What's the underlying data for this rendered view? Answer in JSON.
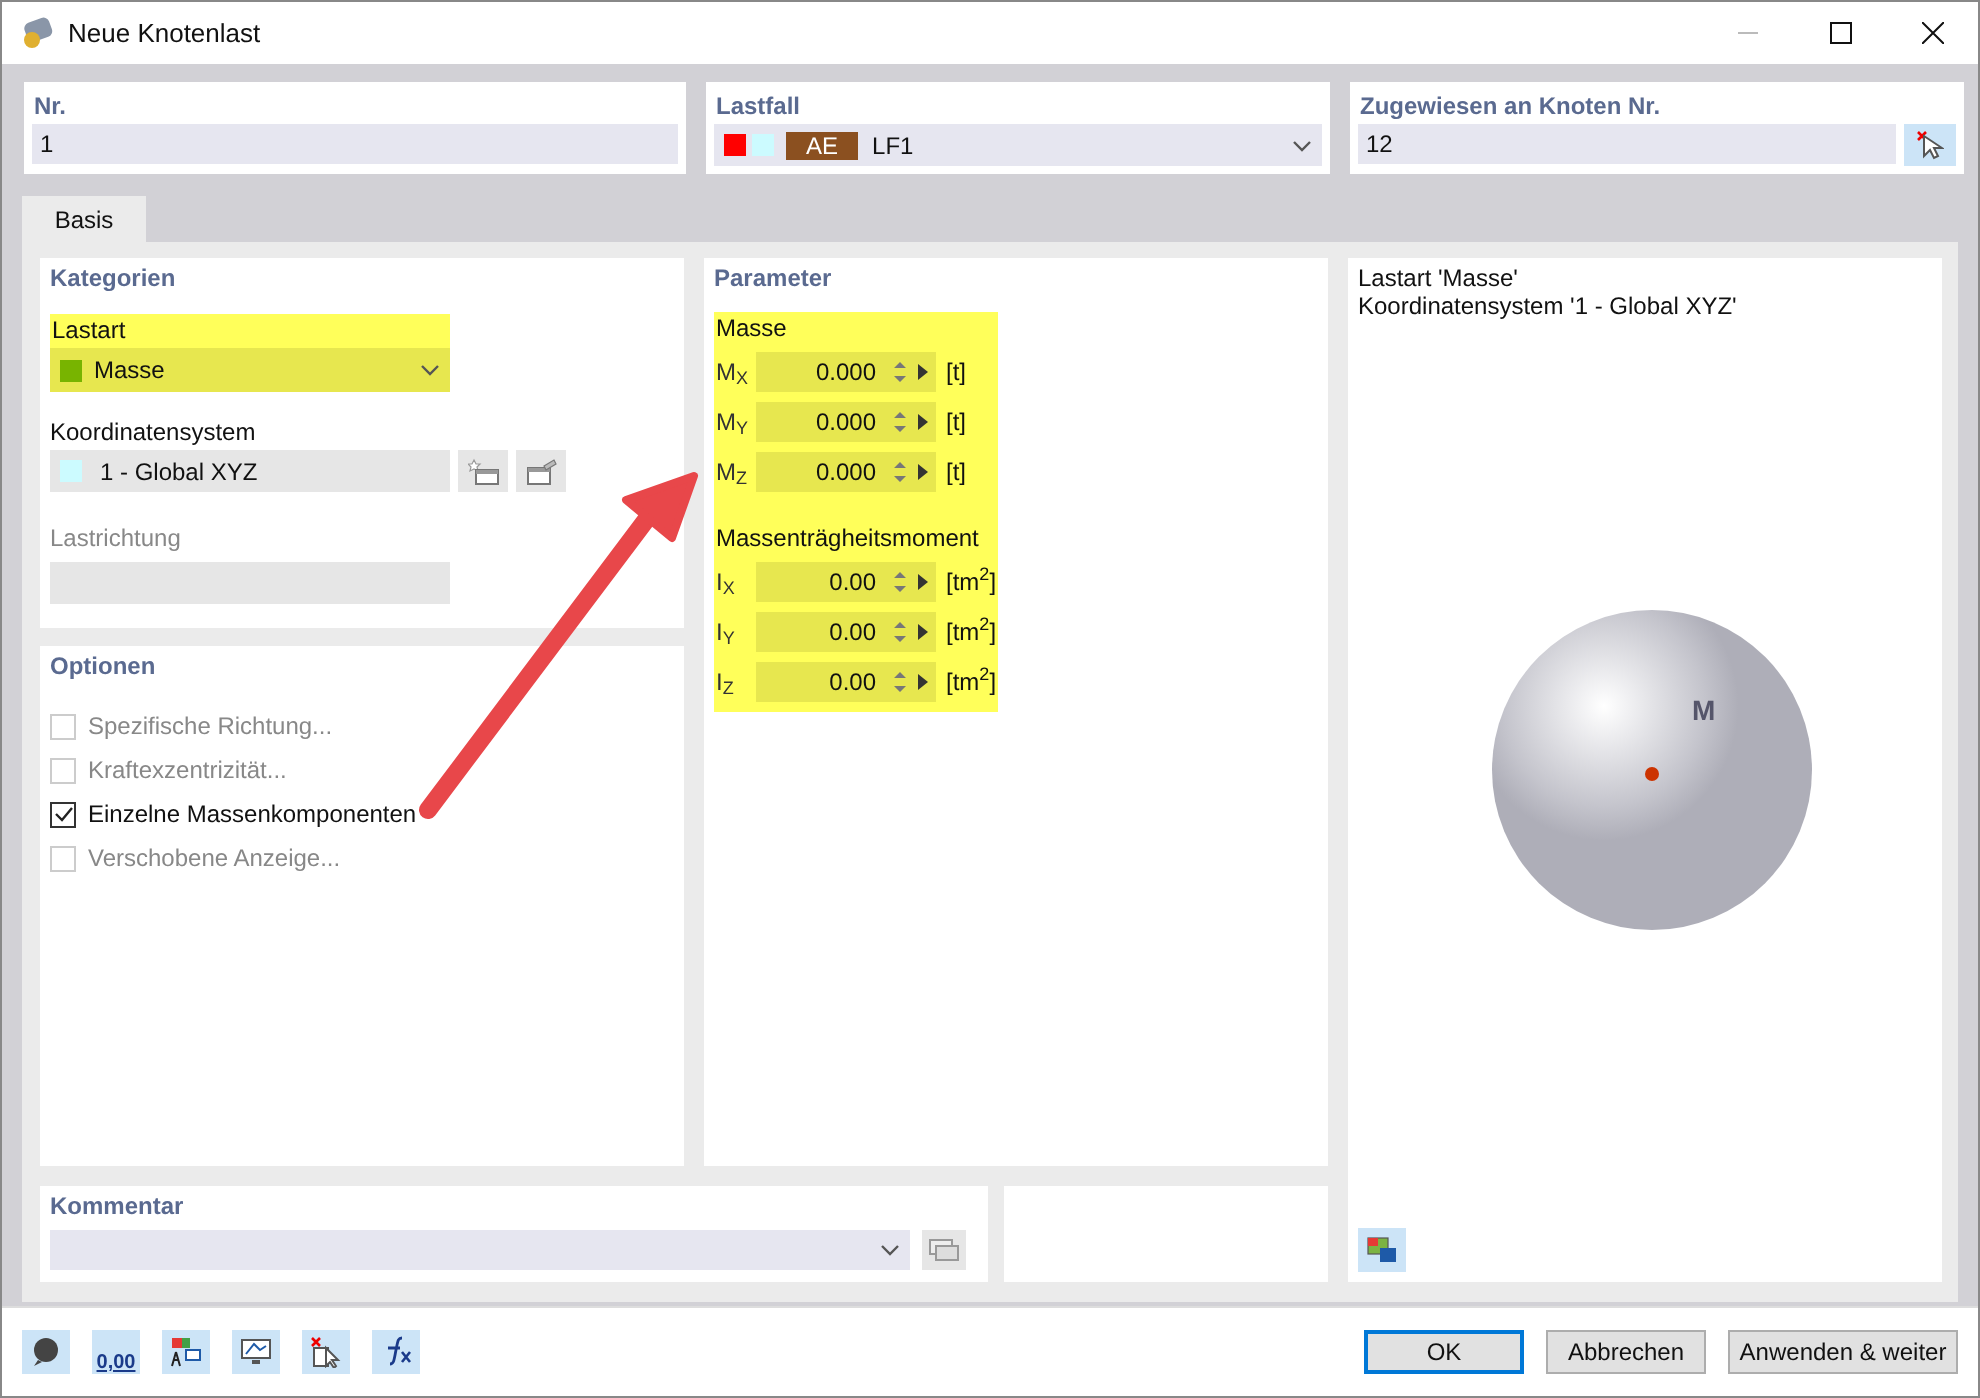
{
  "window": {
    "title": "Neue Knotenlast"
  },
  "nr": {
    "label": "Nr.",
    "value": "1"
  },
  "load_case": {
    "label": "Lastfall",
    "badge": "AE",
    "value": "LF1"
  },
  "assigned": {
    "label": "Zugewiesen an Knoten Nr.",
    "value": "12"
  },
  "tabs": [
    {
      "label": "Basis",
      "selected": true
    }
  ],
  "categories": {
    "title": "Kategorien",
    "load_type": {
      "label": "Lastart",
      "value": "Masse",
      "highlighted": true
    },
    "coordinate_system": {
      "label": "Koordinatensystem",
      "value": "1 - Global XYZ"
    },
    "load_direction": {
      "label": "Lastrichtung",
      "disabled": true
    }
  },
  "options": {
    "title": "Optionen",
    "items": [
      {
        "label": "Spezifische Richtung...",
        "checked": false,
        "disabled": true
      },
      {
        "label": "Kraftexzentrizität...",
        "checked": false,
        "disabled": true
      },
      {
        "label": "Einzelne Massenkomponenten",
        "checked": true,
        "disabled": false
      },
      {
        "label": "Verschobene Anzeige...",
        "checked": false,
        "disabled": true
      }
    ]
  },
  "parameter": {
    "title": "Parameter",
    "highlighted": true,
    "groups": [
      {
        "title": "Masse",
        "rows": [
          {
            "symbol": "M$_{X}$",
            "value": "0.000",
            "unit": "[t]"
          },
          {
            "symbol": "M$_{Y}$",
            "value": "0.000",
            "unit": "[t]"
          },
          {
            "symbol": "M$_{Z}$",
            "value": "0.000",
            "unit": "[t]"
          }
        ]
      },
      {
        "title": "Massenträgheitsmoment",
        "rows": [
          {
            "symbol": "I$_{X}$",
            "value": "0.00",
            "unit": "[tm$^{2}$]"
          },
          {
            "symbol": "I$_{Y}$",
            "value": "0.00",
            "unit": "[tm$^{2}$]"
          },
          {
            "symbol": "I$_{Z}$",
            "value": "0.00",
            "unit": "[tm$^{2}$]"
          }
        ]
      }
    ]
  },
  "preview": {
    "lines": [
      "Lastart 'Masse'",
      "Koordinatensystem '1 - Global XYZ'"
    ],
    "mass_label": "M"
  },
  "comment": {
    "label": "Kommentar"
  },
  "toolbar": {
    "units_text": "0,00"
  },
  "buttons": [
    {
      "label": "OK",
      "default": true
    },
    {
      "label": "Abbrechen",
      "default": false
    },
    {
      "label": "Anwenden & weiter",
      "default": false
    }
  ]
}
